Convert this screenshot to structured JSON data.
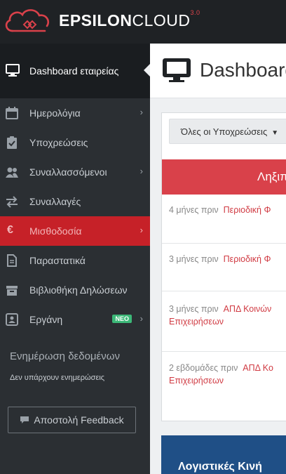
{
  "brand": {
    "name_bold": "EPSILON",
    "name_regular": "CLOUD",
    "version": "3.0",
    "accent": "#e0434b"
  },
  "sidebar": {
    "active_item": {
      "label": "Dashboard εταιρείας",
      "icon": "monitor-icon"
    },
    "items": [
      {
        "label": "Ημερολόγια",
        "icon": "calendar-icon",
        "chevron": true
      },
      {
        "label": "Υποχρεώσεις",
        "icon": "clipboard-check-icon",
        "chevron": false
      },
      {
        "label": "Συναλλασσόμενοι",
        "icon": "users-icon",
        "chevron": true
      },
      {
        "label": "Συναλλαγές",
        "icon": "exchange-icon",
        "chevron": false
      },
      {
        "label": "Μισθοδοσία",
        "icon": "euro-icon",
        "chevron": true,
        "active": true
      },
      {
        "label": "Παραστατικά",
        "icon": "document-icon",
        "chevron": false
      },
      {
        "label": "Βιβλιοθήκη Δηλώσεων",
        "icon": "archive-icon",
        "chevron": false
      },
      {
        "label": "Εργάνη",
        "icon": "id-card-icon",
        "chevron": true,
        "badge": "ΝΕΟ"
      }
    ],
    "update_title": "Ενημέρωση δεδομένων",
    "update_status": "Δεν υπάρχουν ενημερώσεις",
    "feedback_label": "Αποστολή Feedback"
  },
  "main": {
    "page_title": "Dashboard",
    "filter_label": "Όλες οι Υποχρεώσεις",
    "panel_header": "Ληξιπ",
    "rows": [
      {
        "time": "4 μήνες πριν",
        "link": "Περιοδική Φ",
        "link2": ""
      },
      {
        "time": "3 μήνες πριν",
        "link": "Περιοδική Φ",
        "link2": ""
      },
      {
        "time": "3 μήνες πριν",
        "link": "ΑΠΔ Κοινών",
        "link2": "Επιχειρήσεων"
      },
      {
        "time": "2 εβδομάδες πριν",
        "link": "ΑΠΔ Κο",
        "link2": "Επιχειρήσεων"
      }
    ],
    "bottom_panel_title": "Λογιστικές Κινή"
  }
}
